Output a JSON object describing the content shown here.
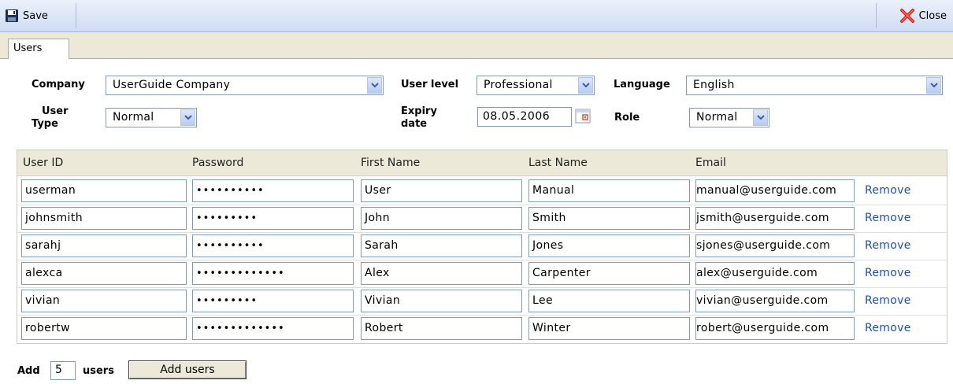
{
  "toolbar": {
    "save_label": "Save",
    "close_label": "Close",
    "save_icon": "floppy-disk-icon",
    "close_icon": "red-x-icon"
  },
  "tabs": [
    {
      "label": "Users",
      "active": true
    }
  ],
  "form": {
    "company_label": "Company",
    "company_value": "UserGuide Company",
    "user_level_label": "User level",
    "user_level_value": "Professional",
    "language_label": "Language",
    "language_value": "English",
    "user_type_label_1": "User",
    "user_type_label_2": "Type",
    "user_type_value": "Normal",
    "expiry_label_1": "Expiry",
    "expiry_label_2": "date",
    "expiry_value": "08.05.2006",
    "role_label": "Role",
    "role_value": "Normal"
  },
  "grid": {
    "headers": [
      "User ID",
      "Password",
      "First Name",
      "Last Name",
      "Email"
    ],
    "remove_label": "Remove",
    "rows": [
      {
        "user_id": "userman",
        "password": "••••••••••",
        "first": "User",
        "last": "Manual",
        "email": "manual@userguide.com"
      },
      {
        "user_id": "johnsmith",
        "password": "•••••••••",
        "first": "John",
        "last": "Smith",
        "email": "jsmith@userguide.com"
      },
      {
        "user_id": "sarahj",
        "password": "••••••••••",
        "first": "Sarah",
        "last": "Jones",
        "email": "sjones@userguide.com"
      },
      {
        "user_id": "alexca",
        "password": "•••••••••••••",
        "first": "Alex",
        "last": "Carpenter",
        "email": "alex@userguide.com"
      },
      {
        "user_id": "vivian",
        "password": "•••••••••",
        "first": "Vivian",
        "last": "Lee",
        "email": "vivian@userguide.com"
      },
      {
        "user_id": "robertw",
        "password": "•••••••••••••",
        "first": "Robert",
        "last": "Winter",
        "email": "robert@userguide.com"
      }
    ]
  },
  "add": {
    "add_label": "Add",
    "count_value": "5",
    "users_label": "users",
    "button_label": "Add users"
  },
  "colors": {
    "toolbar_top": "#ebf1fb",
    "toolbar_bottom": "#cfdcf2",
    "header_bg": "#ece9d8",
    "link": "#1d4fb1",
    "input_border": "#7f9db9"
  }
}
